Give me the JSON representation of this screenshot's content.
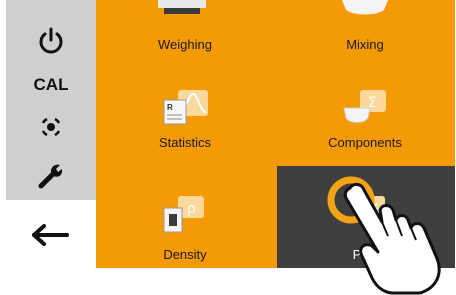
{
  "sidebar": {
    "cal_label": "CAL"
  },
  "tiles": [
    {
      "label": "Weighing"
    },
    {
      "label": "Mixing"
    },
    {
      "label": "Statistics"
    },
    {
      "label": "Components"
    },
    {
      "label": "Density"
    },
    {
      "label": "Pe..."
    }
  ],
  "colors": {
    "accent": "#f49a06",
    "sidebar_gray": "#cfcfcf",
    "selected_tile": "#3f3f3f",
    "highlight_ring": "#f5a316"
  },
  "icons": {
    "power": "power-icon",
    "cal": "calibration",
    "target": "target-icon",
    "wrench": "wrench-icon",
    "back": "back-arrow-icon"
  }
}
